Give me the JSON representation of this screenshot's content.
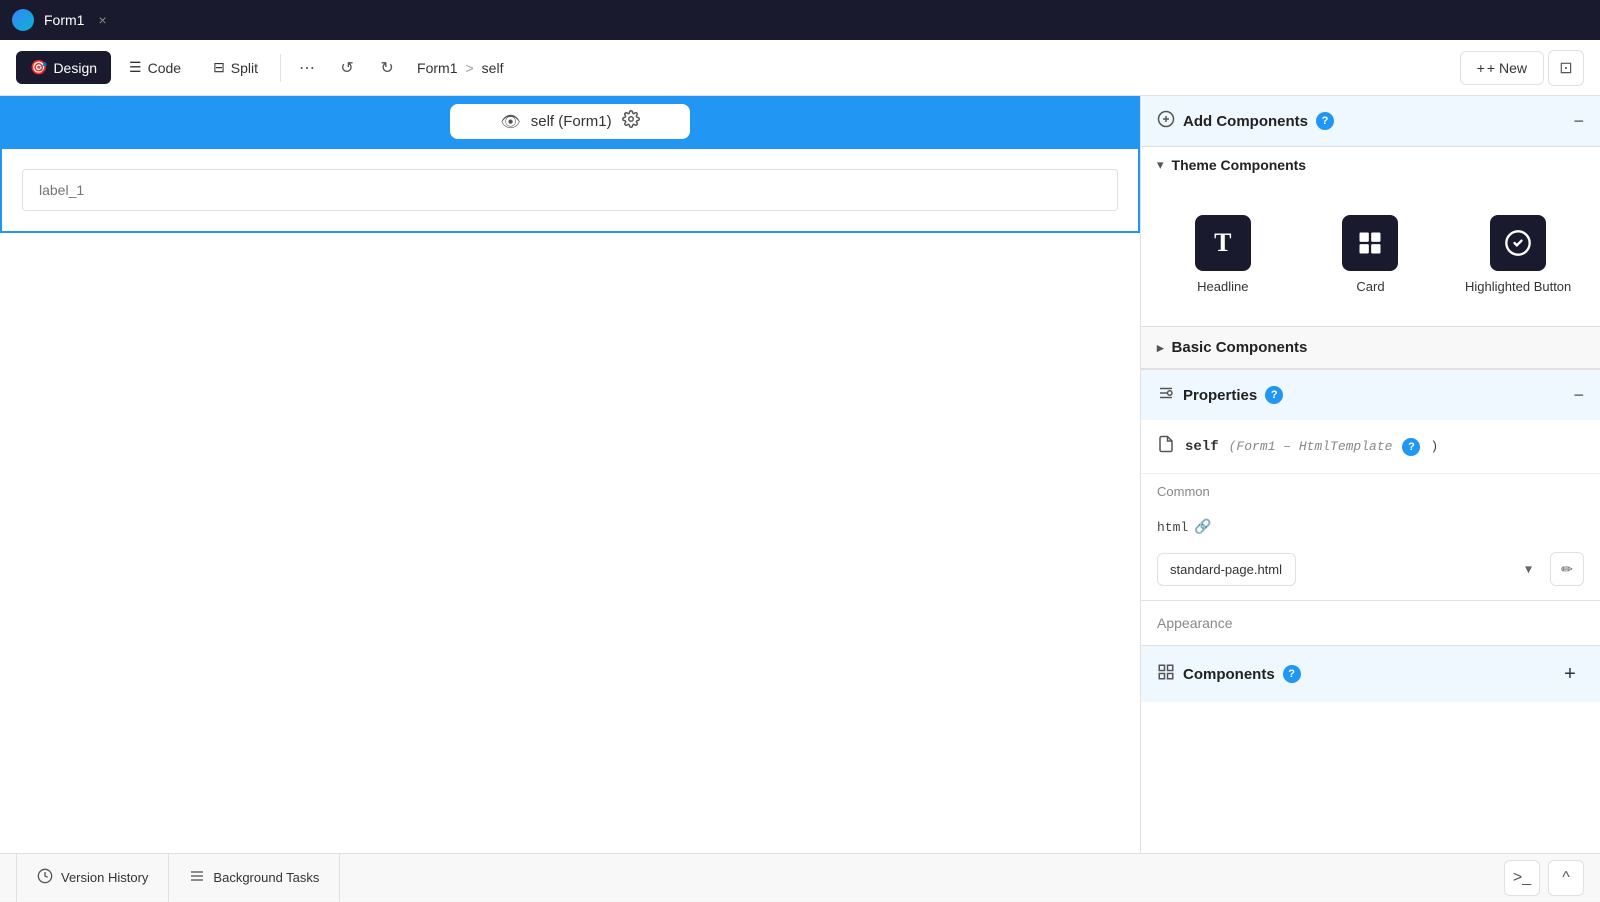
{
  "titleBar": {
    "title": "Form1",
    "closeLabel": "×"
  },
  "toolbar": {
    "designLabel": "Design",
    "codeLabel": "Code",
    "splitLabel": "Split",
    "moreLabel": "⋯",
    "undoLabel": "↺",
    "redoLabel": "↻",
    "breadcrumb": {
      "form": "Form1",
      "separator": ">",
      "page": "self"
    },
    "newLabel": "+ New",
    "layoutIcon": "⊡"
  },
  "canvas": {
    "headerLabel": "self (Form1)",
    "eyeIcon": "👁",
    "settingsIcon": "⚙",
    "formPlaceholder": "label_1"
  },
  "rightPanel": {
    "addComponents": {
      "title": "Add Components",
      "helpIcon": "?",
      "collapseIcon": "−",
      "themeComponents": {
        "title": "Theme Components",
        "items": [
          {
            "label": "Headline",
            "icon": "T"
          },
          {
            "label": "Card",
            "icon": "⊞"
          },
          {
            "label": "Highlighted Button",
            "icon": "👆"
          }
        ]
      },
      "basicComponents": {
        "title": "Basic Components"
      }
    },
    "properties": {
      "title": "Properties",
      "helpIcon": "?",
      "collapseIcon": "−",
      "itemName": "self",
      "itemDetail": "(Form1 – HtmlTemplate",
      "helpIconInline": "?",
      "closeParen": ")",
      "common": {
        "label": "Common",
        "fieldLabel": "html",
        "fieldLinkIcon": "🔗",
        "selectValue": "standard-page.html",
        "editIcon": "✏"
      },
      "appearance": {
        "label": "Appearance"
      }
    },
    "components": {
      "title": "Components",
      "helpIcon": "?",
      "addIcon": "+"
    }
  },
  "bottomBar": {
    "versionHistory": {
      "label": "Version History",
      "icon": "🕐"
    },
    "backgroundTasks": {
      "label": "Background Tasks",
      "icon": "☰"
    },
    "terminalIcon": ">_",
    "chevronIcon": "^"
  }
}
